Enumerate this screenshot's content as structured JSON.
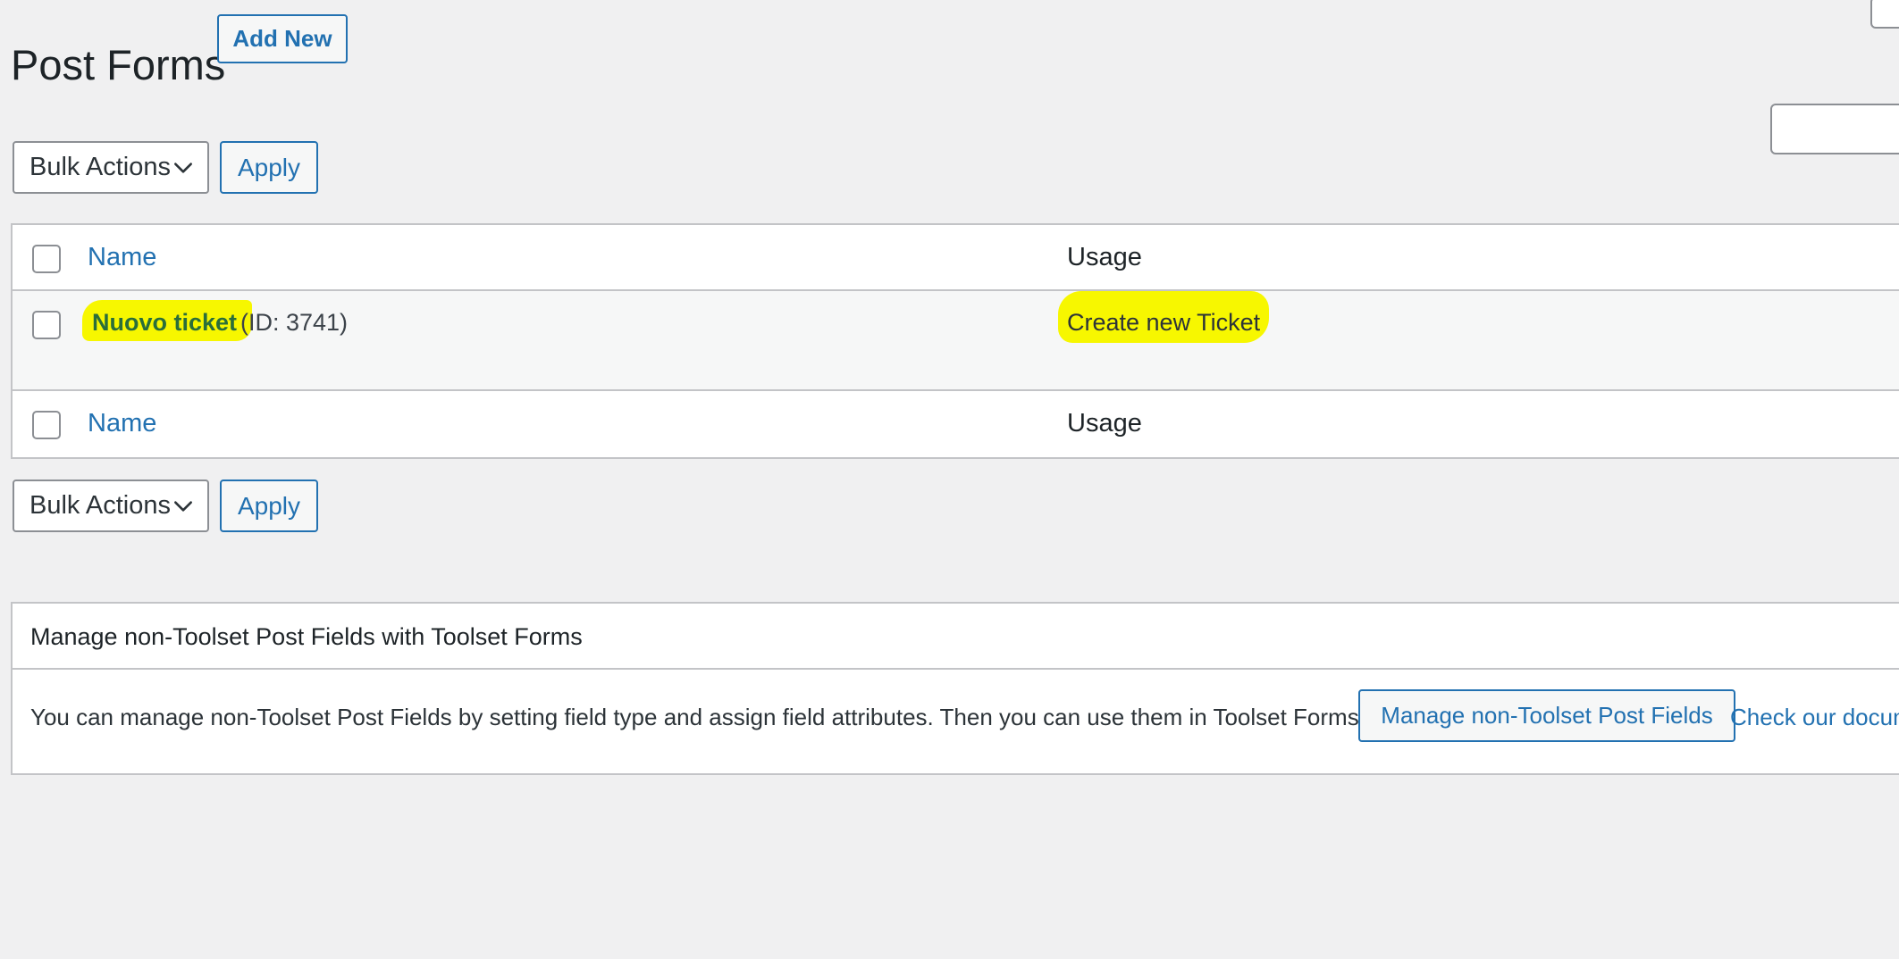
{
  "header": {
    "title": "Post Forms",
    "add_new_label": "Add New"
  },
  "bulk_top": {
    "select_value": "Bulk Actions",
    "apply_label": "Apply"
  },
  "table": {
    "columns": [
      "Name",
      "Usage"
    ],
    "rows": [
      {
        "name": "Nuovo ticket",
        "id_label": "(ID: 3741)",
        "usage": "Create new Ticket"
      }
    ],
    "footer_columns": [
      "Name",
      "Usage"
    ]
  },
  "bulk_bottom": {
    "select_value": "Bulk Actions",
    "apply_label": "Apply"
  },
  "panel": {
    "title": "Manage non-Toolset Post Fields with Toolset Forms",
    "description": "You can manage non-Toolset Post Fields by setting field type and assign field attributes. Then you can use them in Toolset Forms.",
    "manage_button_label": "Manage non-Toolset Post Fields",
    "docs_link_label": "Check our docum"
  },
  "colors": {
    "accent": "#2271b1",
    "highlight": "#f7f700",
    "background": "#f0f0f1"
  },
  "icons": {
    "dropdown": "chevron-down-icon"
  }
}
